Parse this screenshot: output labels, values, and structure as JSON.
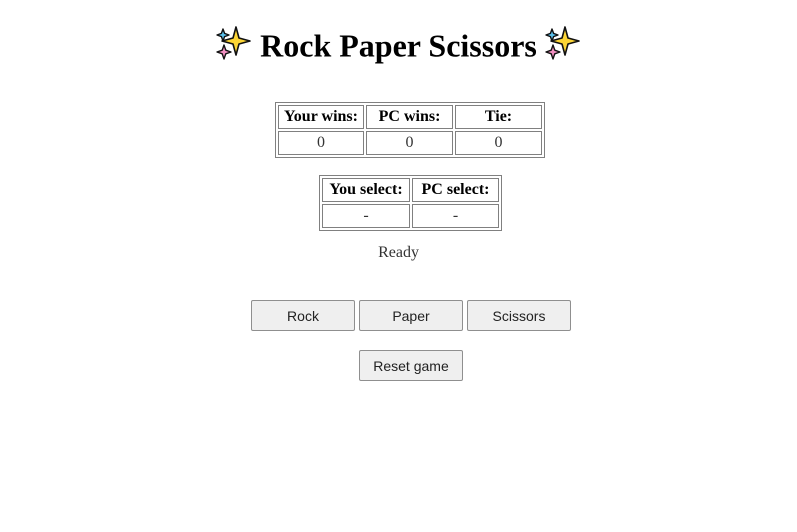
{
  "header": {
    "title": "Rock Paper Scissors",
    "left_icon": "sparkles-icon",
    "right_icon": "sparkles-icon"
  },
  "score": {
    "headers": [
      "Your wins:",
      "PC wins:",
      "Tie:"
    ],
    "values": [
      "0",
      "0",
      "0"
    ]
  },
  "selection": {
    "headers": [
      "You select:",
      "PC select:"
    ],
    "values": [
      "-",
      "-"
    ]
  },
  "status": "Ready",
  "buttons": {
    "rock": "Rock",
    "paper": "Paper",
    "scissors": "Scissors",
    "reset": "Reset game"
  },
  "colors": {
    "sparkle_yellow": "#FCD535",
    "sparkle_blue": "#5BC0EB",
    "sparkle_pink": "#F08FC0"
  }
}
